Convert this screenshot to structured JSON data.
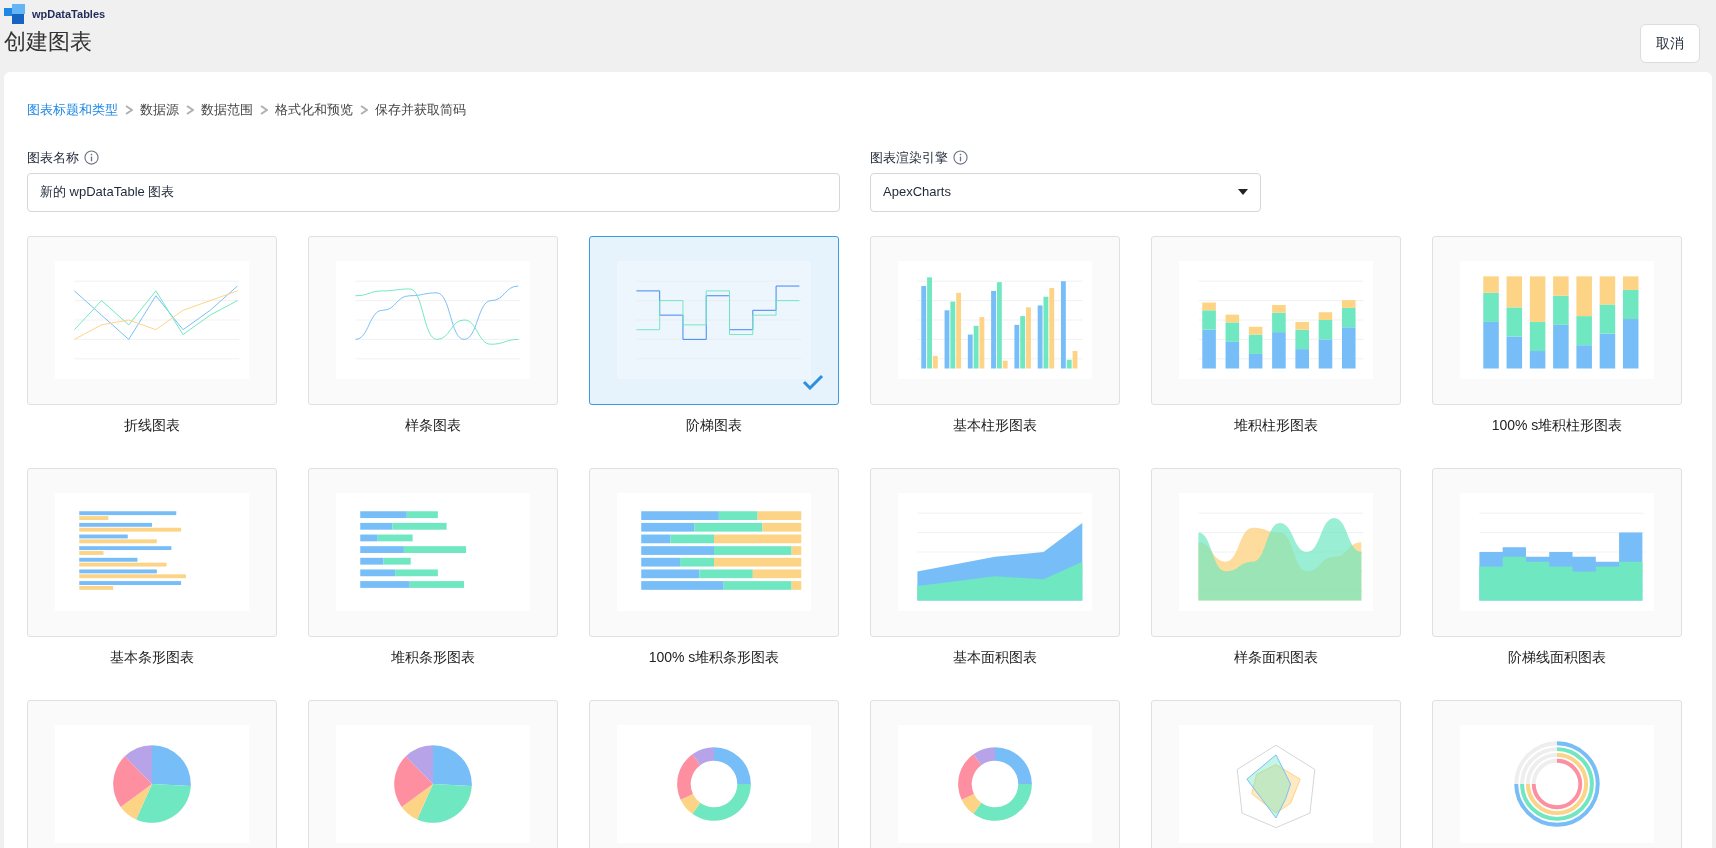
{
  "brand": {
    "name": "wpDataTables"
  },
  "page_title": "创建图表",
  "cancel_button": "取消",
  "steps": [
    {
      "label": "图表标题和类型",
      "selected": true
    },
    {
      "label": "数据源",
      "selected": false
    },
    {
      "label": "数据范围",
      "selected": false
    },
    {
      "label": "格式化和预览",
      "selected": false
    },
    {
      "label": "保存并获取简码",
      "selected": false
    }
  ],
  "name_field": {
    "label": "图表名称",
    "value": "新的 wpDataTable 图表"
  },
  "engine_field": {
    "label": "图表渲染引擎",
    "value": "ApexCharts"
  },
  "chart_types": [
    {
      "kind": "line",
      "label": "折线图表",
      "selected": false
    },
    {
      "kind": "spline",
      "label": "样条图表",
      "selected": false
    },
    {
      "kind": "step",
      "label": "阶梯图表",
      "selected": true
    },
    {
      "kind": "column",
      "label": "基本柱形图表",
      "selected": false
    },
    {
      "kind": "stacked-column",
      "label": "堆积柱形图表",
      "selected": false
    },
    {
      "kind": "stacked-column-100",
      "label": "100% s堆积柱形图表",
      "selected": false
    },
    {
      "kind": "bar",
      "label": "基本条形图表",
      "selected": false
    },
    {
      "kind": "stacked-bar",
      "label": "堆积条形图表",
      "selected": false
    },
    {
      "kind": "stacked-bar-100",
      "label": "100% s堆积条形图表",
      "selected": false
    },
    {
      "kind": "area",
      "label": "基本面积图表",
      "selected": false
    },
    {
      "kind": "spline-area",
      "label": "样条面积图表",
      "selected": false
    },
    {
      "kind": "step-area",
      "label": "阶梯线面积图表",
      "selected": false
    },
    {
      "kind": "pie",
      "selected": false
    },
    {
      "kind": "pie",
      "selected": false
    },
    {
      "kind": "donut",
      "selected": false
    },
    {
      "kind": "donut",
      "selected": false
    },
    {
      "kind": "radar",
      "selected": false
    },
    {
      "kind": "radial",
      "selected": false
    }
  ]
}
